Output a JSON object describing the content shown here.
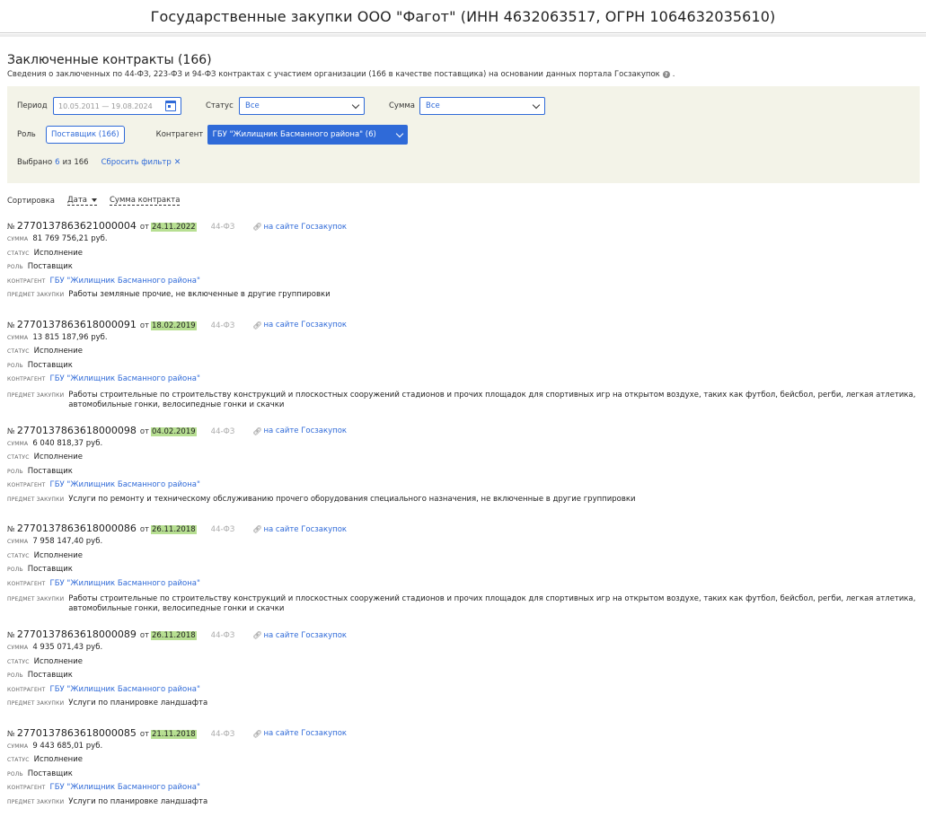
{
  "header": {
    "title": "Государственные закупки ООО \"Фагот\" (ИНН 4632063517, ОГРН 1064632035610)"
  },
  "page": {
    "title": "Заключенные контракты (166)",
    "subtitle": "Сведения о заключенных по 44-ФЗ, 223-ФЗ и 94-ФЗ контрактах с участием организации (166 в качестве поставщика) на основании данных портала Госзакупок"
  },
  "filters": {
    "period_label": "Период",
    "period_value": "10.05.2011 — 19.08.2024",
    "status_label": "Статус",
    "status_value": "Все",
    "sum_label": "Сумма",
    "sum_value": "Все",
    "role_label": "Роль",
    "role_value": "Поставщик (166)",
    "contragent_label": "Контрагент",
    "contragent_value": "ГБУ \"Жилищник Басманного района\" (6)",
    "selected_prefix": "Выбрано",
    "selected_count": "6",
    "selected_suffix": "из 166",
    "reset_label": "Сбросить фильтр"
  },
  "sort": {
    "label": "Сортировка",
    "by_date": "Дата",
    "by_sum": "Сумма контракта"
  },
  "field_labels": {
    "sum": "сумма",
    "status": "статус",
    "role": "роль",
    "contragent": "контрагент",
    "subject": "предмет закупки"
  },
  "contract_prefix": "№",
  "date_prefix": "от",
  "link_label": "на сайте Госзакупок",
  "contracts": [
    {
      "number": "2770137863621000004",
      "date": "24.11.2022",
      "law": "44-ФЗ",
      "sum": "81 769 756,21 руб.",
      "status": "Исполнение",
      "role": "Поставщик",
      "contragent": "ГБУ \"Жилищник Басманного района\"",
      "subject": "Работы земляные прочие, не включенные в другие группировки"
    },
    {
      "number": "2770137863618000091",
      "date": "18.02.2019",
      "law": "44-ФЗ",
      "sum": "13 815 187,96 руб.",
      "status": "Исполнение",
      "role": "Поставщик",
      "contragent": "ГБУ \"Жилищник Басманного района\"",
      "subject": "Работы строительные по строительству конструкций и плоскостных сооружений стадионов и прочих площадок для спортивных игр на открытом воздухе, таких как футбол, бейсбол, регби, легкая атлетика, автомобильные гонки, велосипедные гонки и скачки"
    },
    {
      "number": "2770137863618000098",
      "date": "04.02.2019",
      "law": "44-ФЗ",
      "sum": "6 040 818,37 руб.",
      "status": "Исполнение",
      "role": "Поставщик",
      "contragent": "ГБУ \"Жилищник Басманного района\"",
      "subject": "Услуги по ремонту и техническому обслуживанию прочего оборудования специального назначения, не включенные в другие группировки"
    },
    {
      "number": "2770137863618000086",
      "date": "26.11.2018",
      "law": "44-ФЗ",
      "sum": "7 958 147,40 руб.",
      "status": "Исполнение",
      "role": "Поставщик",
      "contragent": "ГБУ \"Жилищник Басманного района\"",
      "subject": "Работы строительные по строительству конструкций и плоскостных сооружений стадионов и прочих площадок для спортивных игр на открытом воздухе, таких как футбол, бейсбол, регби, легкая атлетика, автомобильные гонки, велосипедные гонки и скачки"
    },
    {
      "number": "2770137863618000089",
      "date": "26.11.2018",
      "law": "44-ФЗ",
      "sum": "4 935 071,43 руб.",
      "status": "Исполнение",
      "role": "Поставщик",
      "contragent": "ГБУ \"Жилищник Басманного района\"",
      "subject": "Услуги по планировке ландшафта"
    },
    {
      "number": "2770137863618000085",
      "date": "21.11.2018",
      "law": "44-ФЗ",
      "sum": "9 443 685,01 руб.",
      "status": "Исполнение",
      "role": "Поставщик",
      "contragent": "ГБУ \"Жилищник Басманного района\"",
      "subject": "Услуги по планировке ландшафта"
    }
  ]
}
